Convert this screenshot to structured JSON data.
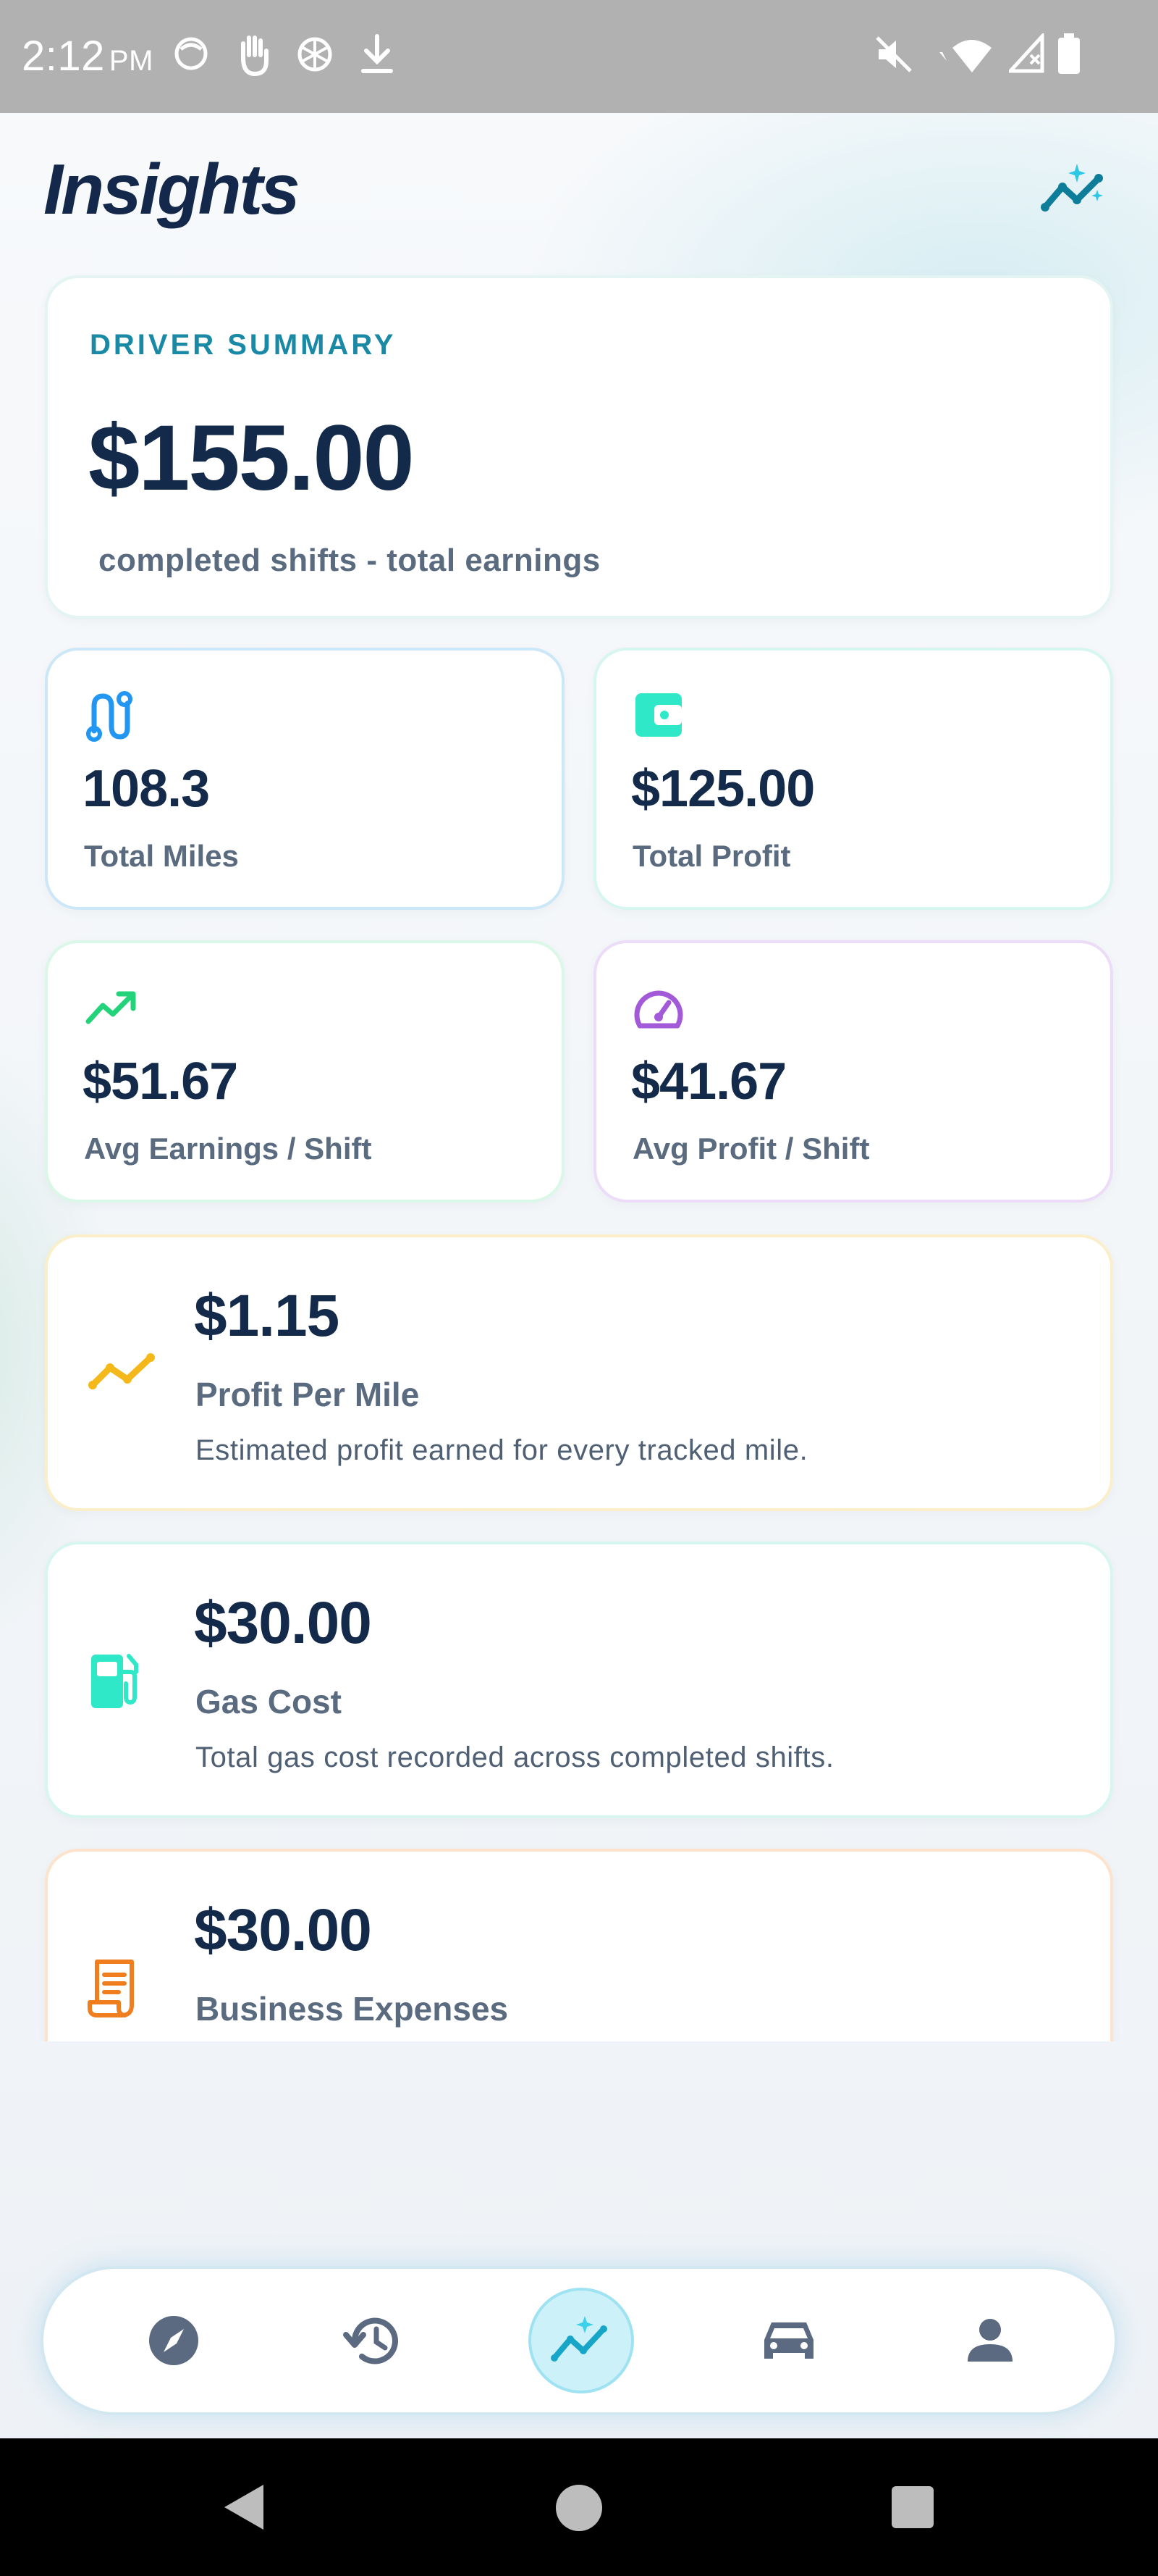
{
  "status_bar": {
    "time": "2:12",
    "ampm": "PM"
  },
  "header": {
    "title": "Insights",
    "icon": "sparkle-chart-icon"
  },
  "summary": {
    "label": "DRIVER SUMMARY",
    "value": "$155.00",
    "subtitle": "completed shifts - total earnings"
  },
  "stats": [
    {
      "icon": "route-icon",
      "value": "108.3",
      "label": "Total Miles",
      "color": "#2196f3"
    },
    {
      "icon": "wallet-icon",
      "value": "$125.00",
      "label": "Total Profit",
      "color": "#2ee8c8"
    },
    {
      "icon": "trending-up-icon",
      "value": "$51.67",
      "label": "Avg Earnings / Shift",
      "color": "#22d37a"
    },
    {
      "icon": "speedometer-icon",
      "value": "$41.67",
      "label": "Avg Profit / Shift",
      "color": "#a25ad8"
    }
  ],
  "metrics": [
    {
      "icon": "line-chart-icon",
      "value": "$1.15",
      "label": "Profit Per Mile",
      "description": "Estimated profit earned for every tracked mile.",
      "color": "#f4b81a"
    },
    {
      "icon": "gas-pump-icon",
      "value": "$30.00",
      "label": "Gas Cost",
      "description": "Total gas cost recorded across completed shifts.",
      "color": "#2ee8c8"
    },
    {
      "icon": "receipt-icon",
      "value": "$30.00",
      "label": "Business Expenses",
      "description": "",
      "color": "#f07e1f"
    }
  ],
  "nav": {
    "items": [
      "compass-icon",
      "history-icon",
      "insights-icon",
      "car-icon",
      "profile-icon"
    ],
    "active": "insights-icon"
  },
  "colors": {
    "accent": "#1989a6",
    "text_dark": "#132a4a",
    "text_muted": "#5a6b80"
  }
}
